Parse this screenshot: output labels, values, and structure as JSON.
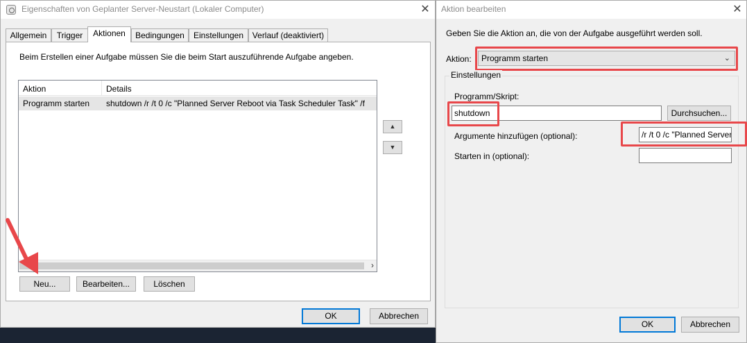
{
  "left_window": {
    "title": "Eigenschaften von Geplanter Server-Neustart (Lokaler Computer)",
    "tabs": [
      "Allgemein",
      "Trigger",
      "Aktionen",
      "Bedingungen",
      "Einstellungen",
      "Verlauf (deaktiviert)"
    ],
    "active_tab": "Aktionen",
    "description": "Beim Erstellen einer Aufgabe müssen Sie die beim Start auszuführende Aufgabe angeben.",
    "table": {
      "columns": [
        "Aktion",
        "Details"
      ],
      "rows": [
        [
          "Programm starten",
          "shutdown /r /t 0 /c \"Planned Server Reboot via Task Scheduler Task\" /f"
        ]
      ]
    },
    "buttons": {
      "new": "Neu...",
      "edit": "Bearbeiten...",
      "delete": "Löschen",
      "ok": "OK",
      "cancel": "Abbrechen",
      "move_up": "▲",
      "move_down": "▼"
    }
  },
  "right_window": {
    "title": "Aktion bearbeiten",
    "instruction": "Geben Sie die Aktion an, die von der Aufgabe ausgeführt werden soll.",
    "action_label": "Aktion:",
    "action_value": "Programm starten",
    "settings_group": "Einstellungen",
    "program_label": "Programm/Skript:",
    "program_value": "shutdown",
    "browse_button": "Durchsuchen...",
    "arguments_label": "Argumente hinzufügen (optional):",
    "arguments_value": "/r /t 0 /c \"Planned Server",
    "start_in_label": "Starten in (optional):",
    "start_in_value": "",
    "ok": "OK",
    "cancel": "Abbrechen"
  },
  "icons": {
    "close": "close-icon",
    "app": "task-scheduler-icon",
    "dropdown": "chevron-down-icon",
    "scroll_right": "chevron-right-icon",
    "annotation": "red-arrow-icon"
  },
  "colors": {
    "highlight": "#e8474a",
    "accent": "#0078d7",
    "window_bg": "#f0f0f0"
  }
}
